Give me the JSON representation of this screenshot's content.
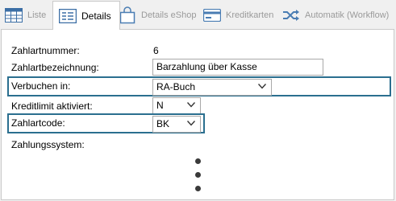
{
  "tabs": [
    {
      "label": "Liste",
      "icon": "grid-icon",
      "active": false
    },
    {
      "label": "Details",
      "icon": "details-form-icon",
      "active": true
    },
    {
      "label": "Details eShop",
      "icon": "shopping-bag-icon",
      "active": false
    },
    {
      "label": "Kreditkarten",
      "icon": "credit-card-icon",
      "active": false
    },
    {
      "label": "Automatik (Workflow)",
      "icon": "shuffle-icon",
      "active": false
    }
  ],
  "form": {
    "zahlartnummer": {
      "label": "Zahlartnummer:",
      "value": "6"
    },
    "zahlartbezeichnung": {
      "label": "Zahlartbezeichnung:",
      "value": "Barzahlung über Kasse"
    },
    "verbuchen_in": {
      "label": "Verbuchen in:",
      "value": "RA-Buch"
    },
    "kreditlimit": {
      "label": "Kreditlimit aktiviert:",
      "value": "N"
    },
    "zahlartcode": {
      "label": "Zahlartcode:",
      "value": "BK"
    },
    "zahlungssystem": {
      "label": "Zahlungssystem:"
    }
  },
  "colors": {
    "highlight_border": "#2b6f8f",
    "icon_blue": "#3b6ea5",
    "tab_inactive_text": "#9a9a9a"
  }
}
